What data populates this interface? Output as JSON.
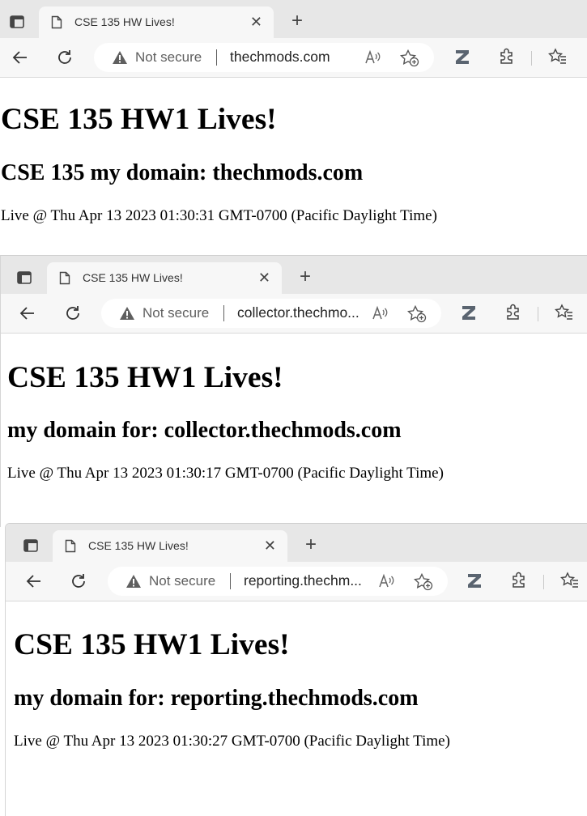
{
  "windows": [
    {
      "tab_title": "CSE 135 HW Lives!",
      "security_label": "Not secure",
      "url": "thechmods.com",
      "heading": "CSE 135 HW1 Lives!",
      "subheading": "CSE 135 my domain: thechmods.com",
      "live_text": "Live @ Thu Apr 13 2023 01:30:31 GMT-0700 (Pacific Daylight Time)"
    },
    {
      "tab_title": "CSE 135 HW Lives!",
      "security_label": "Not secure",
      "url": "collector.thechmo...",
      "heading": "CSE 135 HW1 Lives!",
      "subheading": "my domain for: collector.thechmods.com",
      "live_text": "Live @ Thu Apr 13 2023 01:30:17 GMT-0700 (Pacific Daylight Time)"
    },
    {
      "tab_title": "CSE 135 HW Lives!",
      "security_label": "Not secure",
      "url": "reporting.thechm...",
      "heading": "CSE 135 HW1 Lives!",
      "subheading": "my domain for: reporting.thechmods.com",
      "live_text": "Live @ Thu Apr 13 2023 01:30:27 GMT-0700 (Pacific Daylight Time)"
    }
  ],
  "icons": {
    "tab_actions": "tab-actions-icon",
    "page": "page-icon",
    "close": "close-icon",
    "new_tab": "plus-icon",
    "back": "back-arrow-icon",
    "refresh": "refresh-icon",
    "warning": "warning-icon",
    "read_aloud": "read-aloud-icon",
    "add_favorite": "star-add-icon",
    "extension_z": "z-extension-icon",
    "extensions": "puzzle-icon",
    "favorites": "favorites-icon"
  },
  "colors": {
    "tab_strip": "#e7e7e7",
    "toolbar": "#f7f7f7",
    "icon": "#444444",
    "warning_icon": "#5f5f5f"
  }
}
